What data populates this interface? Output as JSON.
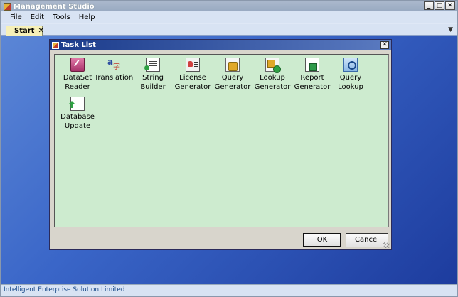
{
  "app": {
    "title": "Management Studio"
  },
  "window_buttons": {
    "minimize": "_",
    "maximize": "□",
    "close": "✕"
  },
  "menu": [
    "File",
    "Edit",
    "Tools",
    "Help"
  ],
  "tabs": [
    {
      "label": "Start",
      "close": "✕"
    }
  ],
  "tab_menu_glyph": "▼",
  "dialog": {
    "title": "Task List",
    "close": "✕",
    "tasks": [
      {
        "label": "DataSet\nReader",
        "icon": "dataset-reader-icon"
      },
      {
        "label": "Translation",
        "icon": "translation-icon"
      },
      {
        "label": "String\nBuilder",
        "icon": "string-builder-icon"
      },
      {
        "label": "License\nGenerator",
        "icon": "license-generator-icon"
      },
      {
        "label": "Query\nGenerator",
        "icon": "query-generator-icon"
      },
      {
        "label": "Lookup\nGenerator",
        "icon": "lookup-generator-icon"
      },
      {
        "label": "Report\nGenerator",
        "icon": "report-generator-icon"
      },
      {
        "label": "Query\nLookup",
        "icon": "query-lookup-icon"
      },
      {
        "label": "Database\nUpdate",
        "icon": "database-update-icon"
      }
    ],
    "ok_label": "OK",
    "cancel_label": "Cancel"
  },
  "status": {
    "text": "Intelligent Enterprise Solution Limited"
  },
  "colors": {
    "desktop_top": "#5b86d6",
    "desktop_bottom": "#1d3c9e",
    "task_panel": "#cdebcf"
  }
}
